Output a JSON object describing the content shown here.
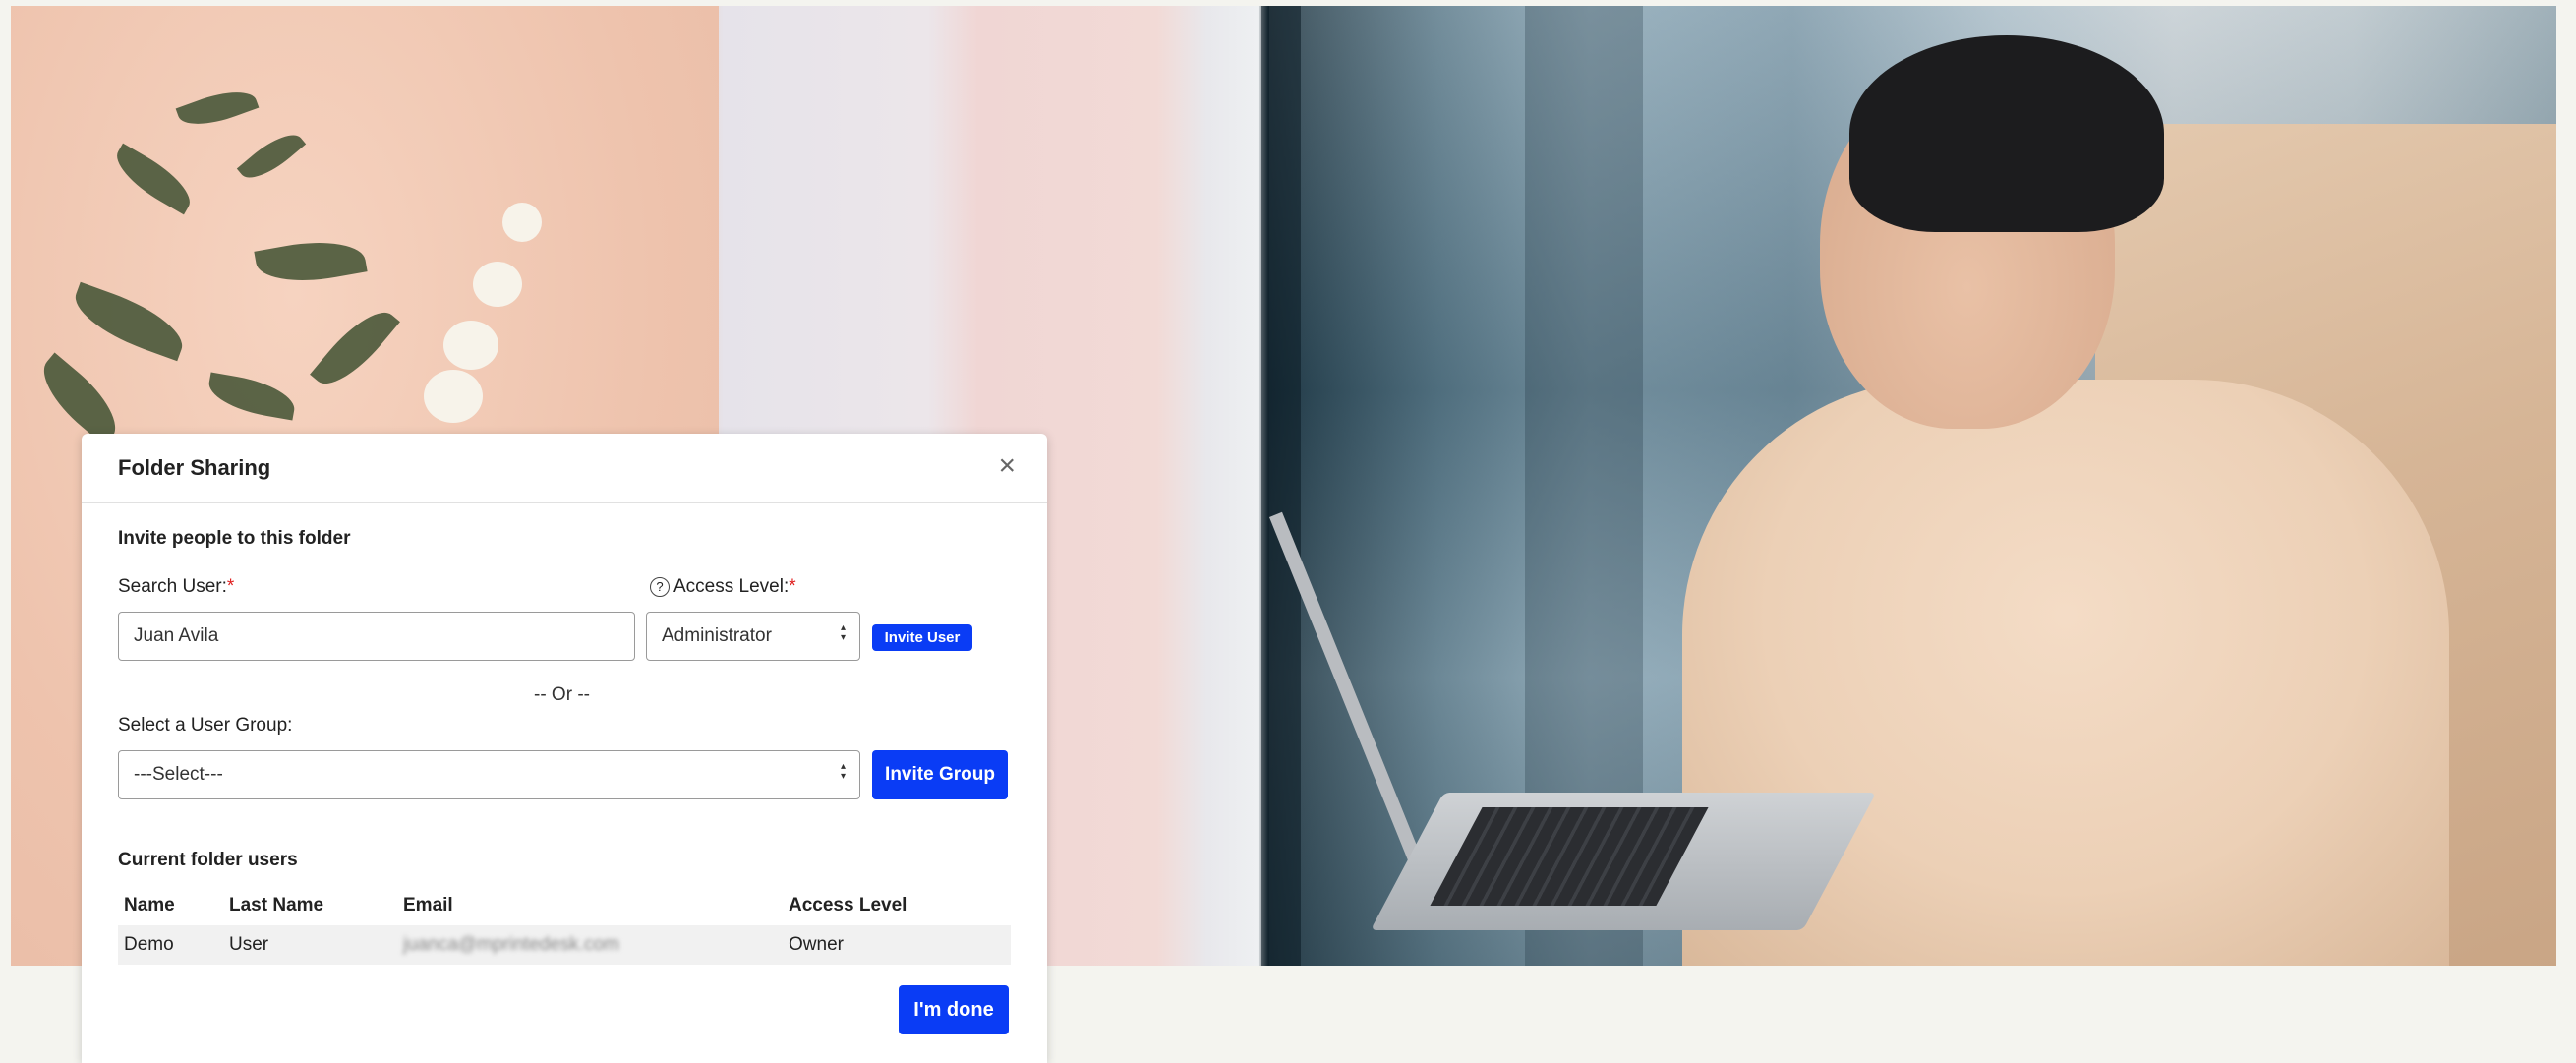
{
  "modal": {
    "title": "Folder Sharing",
    "close_symbol": "×",
    "invite_section_title": "Invite people to this folder",
    "search_user_label": "Search User:",
    "access_level_label": "Access Level:",
    "required_mark": "*",
    "help_symbol": "?",
    "search_user_value": "Juan Avila",
    "access_level_value": "Administrator",
    "invite_user_button": "Invite User",
    "or_divider": "-- Or --",
    "user_group_label": "Select a User Group:",
    "user_group_value": "---Select---",
    "invite_group_button": "Invite Group",
    "current_users_title": "Current folder users",
    "table": {
      "columns": [
        "Name",
        "Last Name",
        "Email",
        "Access Level"
      ],
      "rows": [
        {
          "name": "Demo",
          "last_name": "User",
          "email": "juanca@mprintedesk.com",
          "access_level": "Owner"
        }
      ]
    },
    "done_button": "I'm done"
  },
  "colors": {
    "primary": "#0a3cf5",
    "required": "#e02020",
    "page_background": "#f4f4ef"
  },
  "icons": {
    "close": "close-icon",
    "help": "help-circle-icon",
    "select_arrows": "chevron-updown-icon"
  }
}
